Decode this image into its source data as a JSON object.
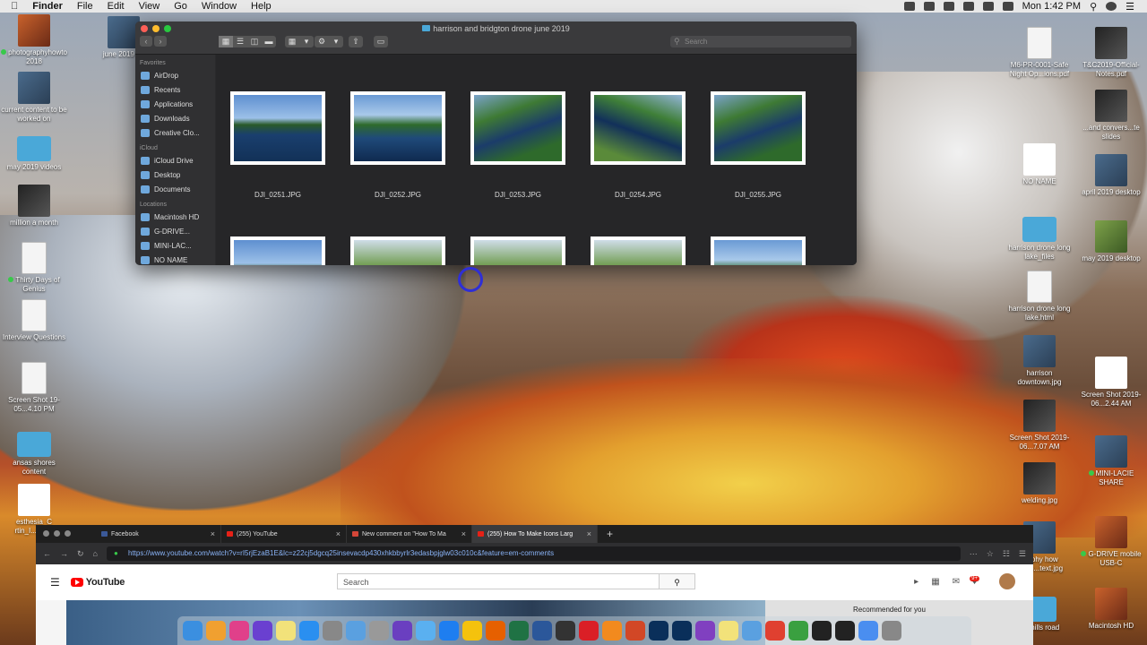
{
  "menubar": {
    "app": "Finder",
    "menus": [
      "File",
      "Edit",
      "View",
      "Go",
      "Window",
      "Help"
    ],
    "clock": "Mon 1:42 PM"
  },
  "desktop_left": [
    {
      "label": "photographyhowto 2018",
      "tag": "green",
      "kind": "photo2"
    },
    {
      "label": "current content to be worked on",
      "kind": "photo"
    },
    {
      "label": "may 2019 videos",
      "kind": "folder"
    },
    {
      "label": "million a month",
      "kind": "dark"
    },
    {
      "label": "Thirty Days of Genius",
      "tag": "green",
      "kind": "doc"
    },
    {
      "label": "Interview Questions",
      "kind": "doc"
    },
    {
      "label": "Screen Shot 19-05...4.10 PM",
      "kind": "doc"
    },
    {
      "label": "ansas shores content",
      "kind": "folder"
    },
    {
      "label": "esthesia_C rtin_I...P3.m",
      "kind": "white"
    }
  ],
  "desktop_top": {
    "label": "june 2019 de",
    "kind": "photo"
  },
  "desktop_right_col1": [
    {
      "label": "M6-PR-0001-Safe Night Op...ions.pdf",
      "kind": "doc"
    },
    {
      "label": "NO NAME",
      "kind": "white"
    },
    {
      "label": "harrison drone long lake_files",
      "kind": "folder"
    },
    {
      "label": "harrison drone long lake.html",
      "kind": "doc"
    },
    {
      "label": "harrison downtown.jpg",
      "kind": "photo"
    },
    {
      "label": "Screen Shot 2019-06...7.07 AM",
      "kind": "dark"
    },
    {
      "label": "welding.jpg",
      "kind": "dark"
    },
    {
      "label": "graphy how ...thin...text.jpg",
      "kind": "photo"
    },
    {
      "label": "we hills road",
      "kind": "folder"
    }
  ],
  "desktop_right_col2": [
    {
      "label": "T&C2019-Official-Notes.pdf",
      "kind": "dark"
    },
    {
      "label": "...and convers...te slides",
      "kind": "dark"
    },
    {
      "label": "april 2019 desktop",
      "kind": "photo"
    },
    {
      "label": "may 2019 desktop",
      "kind": "green"
    },
    {
      "label": "Screen Shot 2019-06...2.44 AM",
      "kind": "white"
    },
    {
      "label": "MINI-LACIE SHARE",
      "tag": "green",
      "kind": "photo"
    },
    {
      "label": "G-DRIVE mobile USB-C",
      "tag": "green",
      "kind": "photo2"
    },
    {
      "label": "Macintosh HD",
      "kind": "photo2"
    }
  ],
  "finder": {
    "title": "harrison and bridgton drone june 2019",
    "search_placeholder": "Search",
    "sidebar": {
      "favorites_header": "Favorites",
      "favorites": [
        "AirDrop",
        "Recents",
        "Applications",
        "Downloads",
        "Creative Clo..."
      ],
      "icloud_header": "iCloud",
      "icloud": [
        "iCloud Drive",
        "Desktop",
        "Documents"
      ],
      "locations_header": "Locations",
      "locations": [
        "Macintosh HD",
        "G-DRIVE...",
        "MINI-LAC...",
        "NO NAME"
      ]
    },
    "files": [
      "DJI_0251.JPG",
      "DJI_0252.JPG",
      "DJI_0253.JPG",
      "DJI_0254.JPG",
      "DJI_0255.JPG"
    ]
  },
  "browser": {
    "tabs": [
      {
        "label": "Facebook",
        "fav": "fb"
      },
      {
        "label": "(255) YouTube",
        "fav": "yt"
      },
      {
        "label": "New comment on \"How To Ma",
        "fav": "gm"
      },
      {
        "label": "(255) How To Make Icons Larg",
        "fav": "yt"
      }
    ],
    "new_tab": "+",
    "url": "https://www.youtube.com/watch?v=rI5rjEzaB1E&lc=z22cj5dgcq25insevacdp430xhkbbyrlr3edasbpjglw03c010c&feature=em-comments",
    "youtube": {
      "logo_text": "YouTube",
      "search_placeholder": "Search",
      "notification_count": "9+",
      "recommended": "Recommended for you"
    }
  },
  "dock_apps": [
    "Finder",
    "Photos",
    "iTunes",
    "Siri",
    "Notes",
    "App Store",
    "System Preferences",
    "Preview",
    "Script Editor",
    "iMovie",
    "Mail",
    "Safari",
    "Chrome",
    "Firefox",
    "Excel",
    "Word",
    "EVS",
    "Creative Cloud",
    "Keynote",
    "PowerPoint",
    "Lightroom",
    "Photoshop",
    "Screen Recorder",
    "Notes",
    "Preview",
    "Calendar",
    "Globe",
    "OBS",
    "Terminal",
    "Download",
    "Trash"
  ]
}
